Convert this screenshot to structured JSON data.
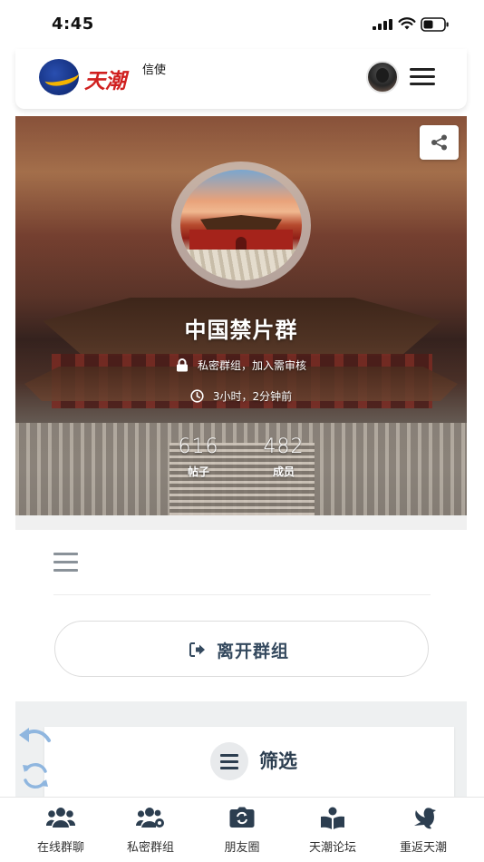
{
  "status_bar": {
    "time": "4:45"
  },
  "header": {
    "logo_text": "天潮",
    "logo_subtext": "信使"
  },
  "group": {
    "name": "中国禁片群",
    "privacy": "私密群组，加入需审核",
    "last_active": "3小时，2分钟前",
    "stats": [
      {
        "value": "616",
        "label": "帖子"
      },
      {
        "value": "482",
        "label": "成员"
      }
    ]
  },
  "actions": {
    "leave_label": "离开群组",
    "filter_label": "筛选"
  },
  "bottom_nav": [
    {
      "label": "在线群聊",
      "icon": "users-icon"
    },
    {
      "label": "私密群组",
      "icon": "users-gear-icon"
    },
    {
      "label": "朋友圈",
      "icon": "camera-retro-icon"
    },
    {
      "label": "天潮论坛",
      "icon": "book-reader-icon"
    },
    {
      "label": "重返天潮",
      "icon": "dove-icon"
    }
  ],
  "colors": {
    "text_dark": "#2c3e50",
    "muted_icon": "#8a9299",
    "logo_red": "#d0201f",
    "logo_blue": "#14307e",
    "logo_yellow": "#f4b400"
  }
}
